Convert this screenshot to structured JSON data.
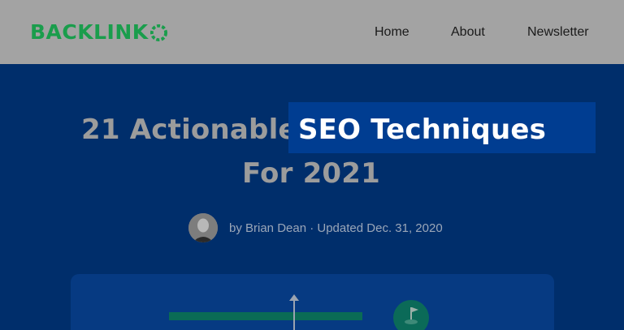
{
  "header": {
    "logo_text": "BACKLINK",
    "logo_last_letter_icon": "logo-o-icon",
    "nav": [
      {
        "label": "Home"
      },
      {
        "label": "About"
      },
      {
        "label": "Newsletter"
      }
    ]
  },
  "hero": {
    "title_part1": "21 Actionable",
    "title_highlight": "SEO Techniques",
    "title_line2": "For 2021",
    "byline": "by Brian Dean · Updated Dec. 31, 2020",
    "avatar_icon": "author-avatar"
  },
  "colors": {
    "logo_green": "#1a9d4c",
    "header_bg": "#a3a3a3",
    "hero_bg": "#002e6b",
    "highlight_bg": "#003d91"
  }
}
